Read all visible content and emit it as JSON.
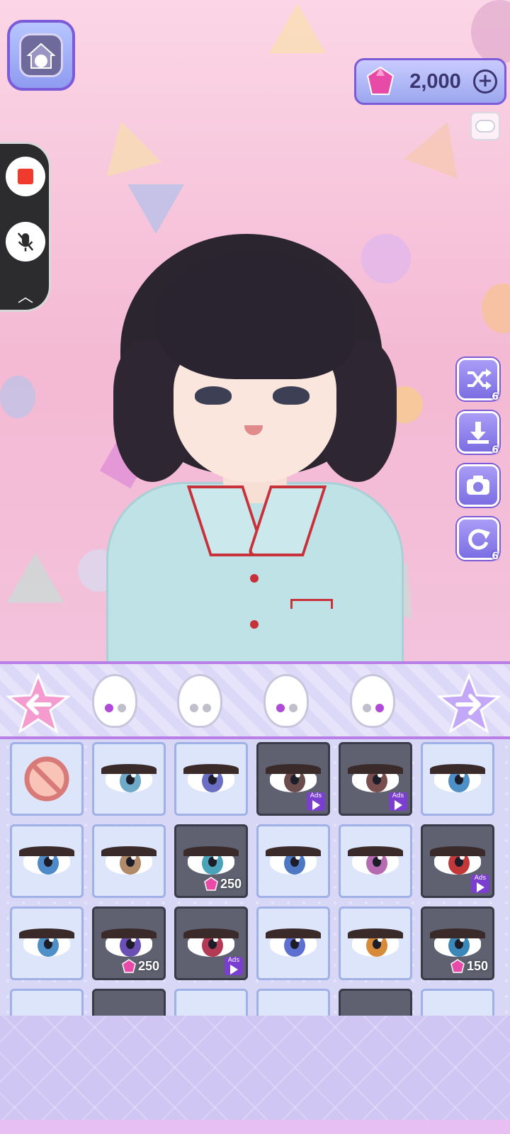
{
  "hud": {
    "gems": "2,000",
    "gem_color": "#e84aa8"
  },
  "tools": [
    {
      "name": "shuffle",
      "count": "6"
    },
    {
      "name": "download",
      "count": "6"
    },
    {
      "name": "camera",
      "count": ""
    },
    {
      "name": "reset",
      "count": "6"
    }
  ],
  "eye_grid": {
    "rows": [
      [
        {
          "type": "none"
        },
        {
          "iris": "#6fa9c8",
          "locked": ""
        },
        {
          "iris": "#6b6fc4",
          "locked": ""
        },
        {
          "iris": "#6b4c4c",
          "locked": "ads"
        },
        {
          "iris": "#7a4e4e",
          "locked": "ads"
        },
        {
          "iris": "#4f8fc7",
          "locked": ""
        }
      ],
      [
        {
          "iris": "#4e8ac8",
          "locked": ""
        },
        {
          "iris": "#b18a6a",
          "locked": ""
        },
        {
          "iris": "#4aa3b8",
          "locked": "gems",
          "price": "250"
        },
        {
          "iris": "#4f78c4",
          "locked": ""
        },
        {
          "iris": "#b66ab1",
          "locked": ""
        },
        {
          "iris": "#c23838",
          "locked": "ads"
        }
      ],
      [
        {
          "iris": "#4f8fc7",
          "locked": ""
        },
        {
          "iris": "#6a4fb5",
          "locked": "gems",
          "price": "250"
        },
        {
          "iris": "#b33a55",
          "locked": "ads"
        },
        {
          "iris": "#5d6fd0",
          "locked": ""
        },
        {
          "iris": "#d78a3a",
          "locked": ""
        },
        {
          "iris": "#3a87b8",
          "locked": "gems",
          "price": "150"
        }
      ]
    ],
    "ads_label": "Ads"
  }
}
